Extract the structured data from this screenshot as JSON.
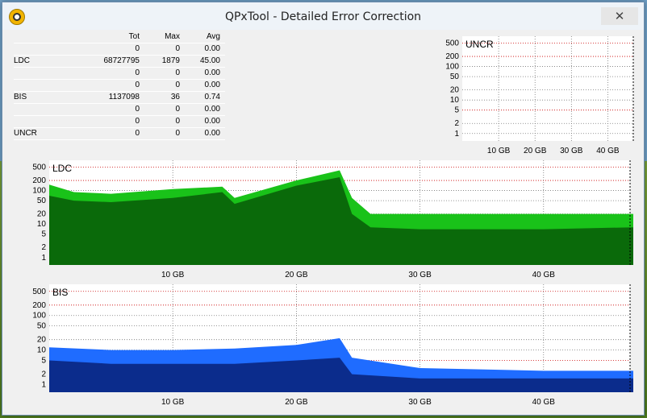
{
  "window": {
    "title": "QPxTool - Detailed Error Correction",
    "close_label": "✕"
  },
  "icons": {
    "app": "qpxtool-icon",
    "close": "close-icon"
  },
  "stats": {
    "headers": [
      "",
      "Tot",
      "Max",
      "Avg"
    ],
    "rows": [
      [
        "",
        "0",
        "0",
        "0.00"
      ],
      [
        "LDC",
        "68727795",
        "1879",
        "45.00"
      ],
      [
        "",
        "0",
        "0",
        "0.00"
      ],
      [
        "",
        "0",
        "0",
        "0.00"
      ],
      [
        "BIS",
        "1137098",
        "36",
        "0.74"
      ],
      [
        "",
        "0",
        "0",
        "0.00"
      ],
      [
        "",
        "0",
        "0",
        "0.00"
      ],
      [
        "UNCR",
        "0",
        "0",
        "0.00"
      ]
    ]
  },
  "colors": {
    "ldc_light": "#19c219",
    "ldc_dark": "#0a6a0a",
    "bis_light": "#1f6cff",
    "bis_dark": "#0b2c8c",
    "grid": "#000000",
    "redline": "#cc0000"
  },
  "chart_data": [
    {
      "type": "area",
      "title": "UNCR",
      "yscale": "log",
      "yticks": [
        "500",
        "200",
        "100",
        "50",
        "20",
        "10",
        "5",
        "2",
        "1"
      ],
      "xticks": [
        "10 GB",
        "20 GB",
        "30 GB",
        "40 GB"
      ],
      "xlim": [
        0,
        47
      ],
      "series": [
        {
          "name": "UNCR",
          "values": [
            0
          ]
        }
      ]
    },
    {
      "type": "area",
      "title": "LDC",
      "yscale": "log",
      "yticks": [
        "500",
        "200",
        "100",
        "50",
        "20",
        "10",
        "5",
        "2",
        "1"
      ],
      "xticks": [
        "10 GB",
        "20 GB",
        "30 GB",
        "40 GB"
      ],
      "xlim": [
        0,
        47
      ],
      "x": [
        0,
        2,
        5,
        10,
        14,
        15,
        20,
        23.5,
        24.5,
        26,
        30,
        40,
        47.3
      ],
      "series": [
        {
          "values": [
            150,
            90,
            80,
            110,
            130,
            60,
            200,
            400,
            60,
            20,
            20,
            20,
            20
          ]
        },
        {
          "values": [
            70,
            50,
            45,
            60,
            90,
            40,
            140,
            250,
            20,
            8,
            7,
            7,
            8
          ]
        }
      ]
    },
    {
      "type": "area",
      "title": "BIS",
      "yscale": "log",
      "yticks": [
        "500",
        "200",
        "100",
        "50",
        "20",
        "10",
        "5",
        "2",
        "1"
      ],
      "xticks": [
        "10 GB",
        "20 GB",
        "30 GB",
        "40 GB"
      ],
      "xlim": [
        0,
        47
      ],
      "x": [
        0,
        5,
        10,
        15,
        20,
        23.5,
        24.5,
        30,
        40,
        47.3
      ],
      "series": [
        {
          "values": [
            12,
            10,
            10,
            11,
            14,
            22,
            6,
            3,
            2.5,
            2.5
          ]
        },
        {
          "values": [
            5,
            4,
            4,
            4,
            5,
            6,
            2,
            1.5,
            1.5,
            1.5
          ]
        }
      ]
    }
  ]
}
